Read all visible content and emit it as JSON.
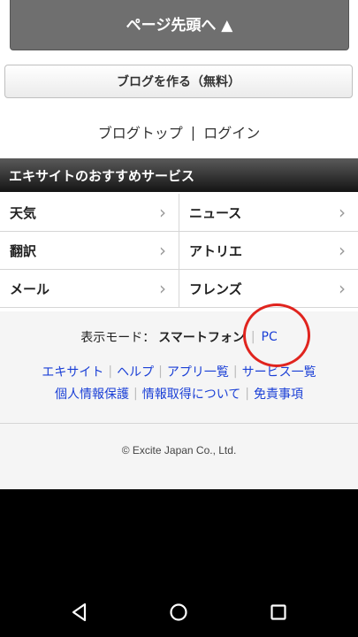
{
  "page_top_button": {
    "label": "ページ先頭へ ▲"
  },
  "create_blog_button": {
    "label": "ブログを作る（無料）"
  },
  "top_links": {
    "blog_top": "ブログトップ",
    "separator": "|",
    "login": "ログイン"
  },
  "services": {
    "header": "エキサイトのおすすめサービス",
    "items": [
      {
        "label": "天気"
      },
      {
        "label": "ニュース"
      },
      {
        "label": "翻訳"
      },
      {
        "label": "アトリエ"
      },
      {
        "label": "メール"
      },
      {
        "label": "フレンズ"
      }
    ],
    "chevron": "›"
  },
  "display_mode": {
    "label": "表示モード：",
    "current": "スマートフォン",
    "alternate": "PC"
  },
  "footer_links_row1": [
    "エキサイト",
    "ヘルプ",
    "アプリ一覧",
    "サービス一覧"
  ],
  "footer_links_row2": [
    "個人情報保護",
    "情報取得について",
    "免責事項"
  ],
  "copyright": "© Excite Japan Co., Ltd.",
  "annotation": {
    "color": "#e0241e"
  },
  "nav_bar": {
    "icons": [
      "back-icon",
      "home-icon",
      "recents-icon"
    ]
  }
}
